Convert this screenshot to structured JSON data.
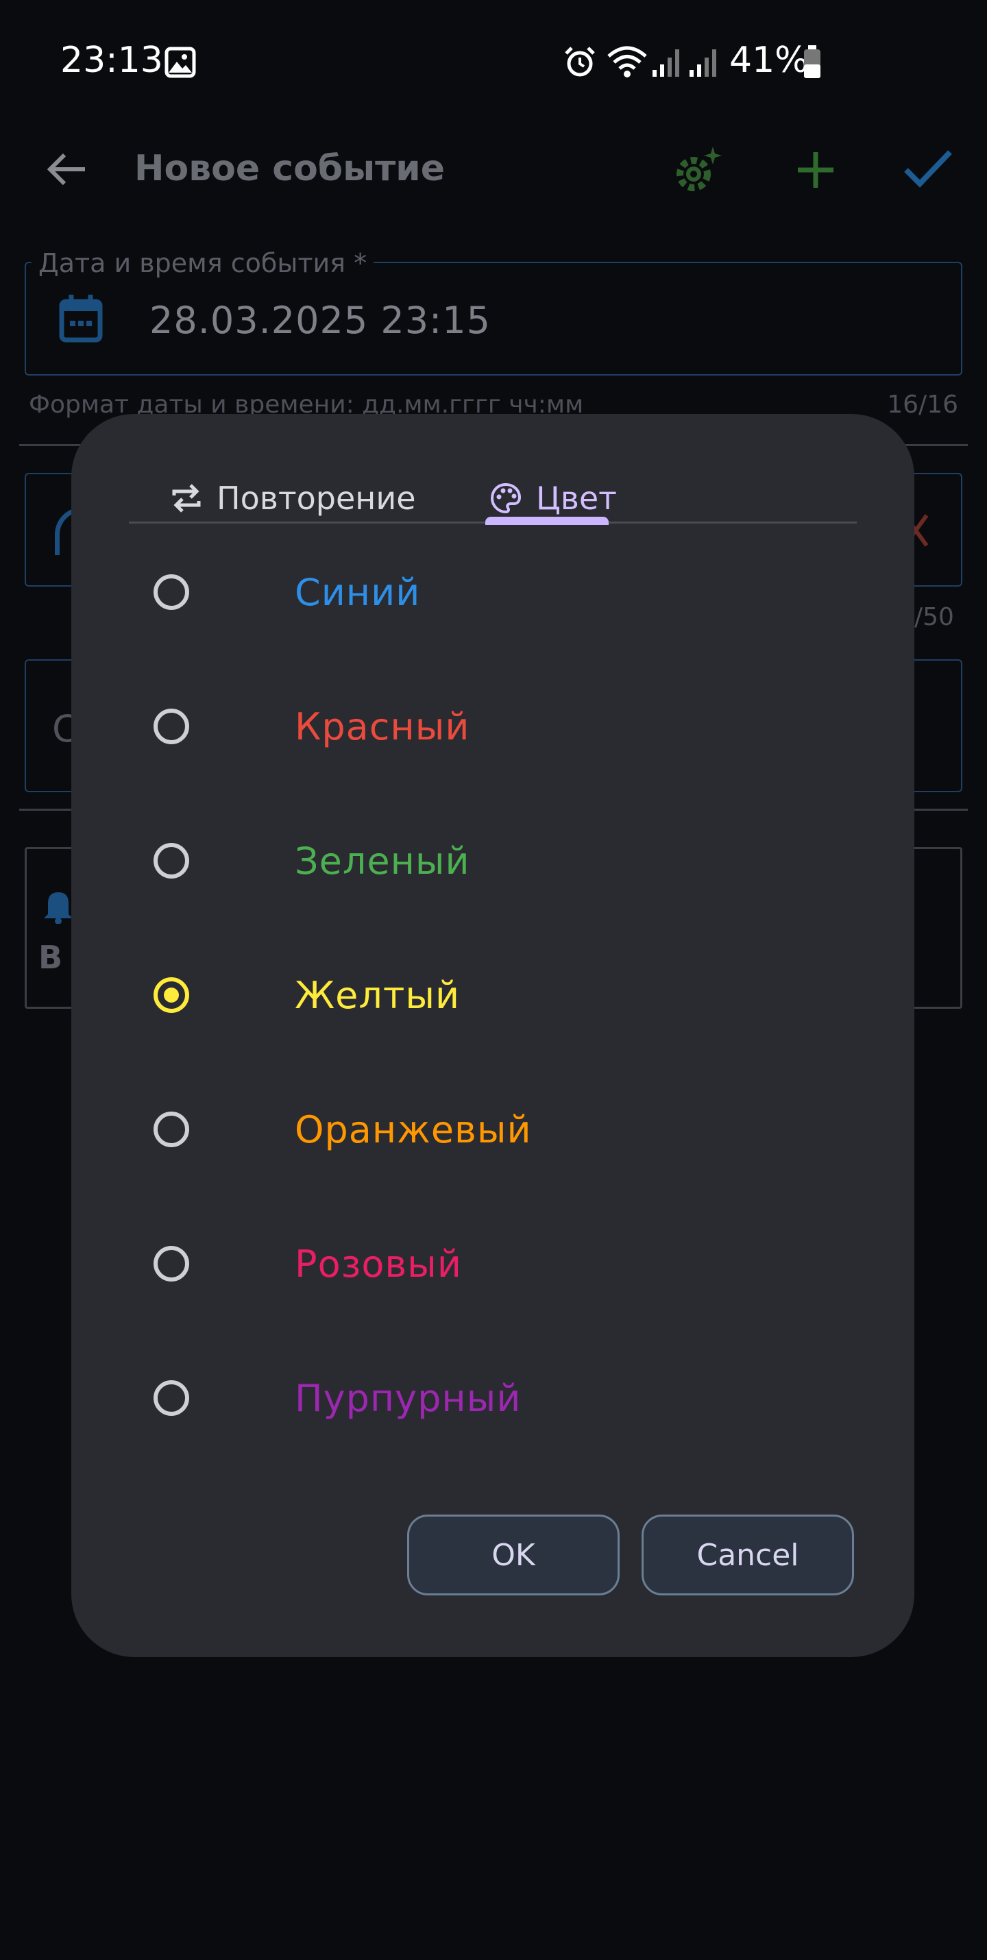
{
  "status_bar": {
    "time": "23:13",
    "battery": "41%"
  },
  "app_bar": {
    "title": "Новое событие"
  },
  "form": {
    "datetime_label": "Дата и время события *",
    "datetime_value": "28.03.2025 23:15",
    "datetime_helper": "Формат даты и времени: дд.мм.гггг чч:мм",
    "datetime_counter": "16/16",
    "second_counter": "/50",
    "third_field_fragment": "С",
    "reminder_fragment": "В"
  },
  "dialog": {
    "tabs": [
      {
        "label": "Повторение",
        "icon": "repeat-icon"
      },
      {
        "label": "Цвет",
        "icon": "palette-icon"
      }
    ],
    "options": [
      {
        "label": "Синий",
        "color": "#2e8fe6",
        "selected": false
      },
      {
        "label": "Красный",
        "color": "#ea4b3c",
        "selected": false
      },
      {
        "label": "Зеленый",
        "color": "#4caf50",
        "selected": false
      },
      {
        "label": "Желтый",
        "color": "#ffeb3b",
        "selected": true
      },
      {
        "label": "Оранжевый",
        "color": "#ff9800",
        "selected": false
      },
      {
        "label": "Розовый",
        "color": "#e91e63",
        "selected": false
      },
      {
        "label": "Пурпурный",
        "color": "#9c27b0",
        "selected": false
      }
    ],
    "ok_label": "OK",
    "cancel_label": "Cancel"
  },
  "colors": {
    "accent": "#cbb6ff",
    "primary": "#1e88e5",
    "green": "#2e7d32"
  }
}
